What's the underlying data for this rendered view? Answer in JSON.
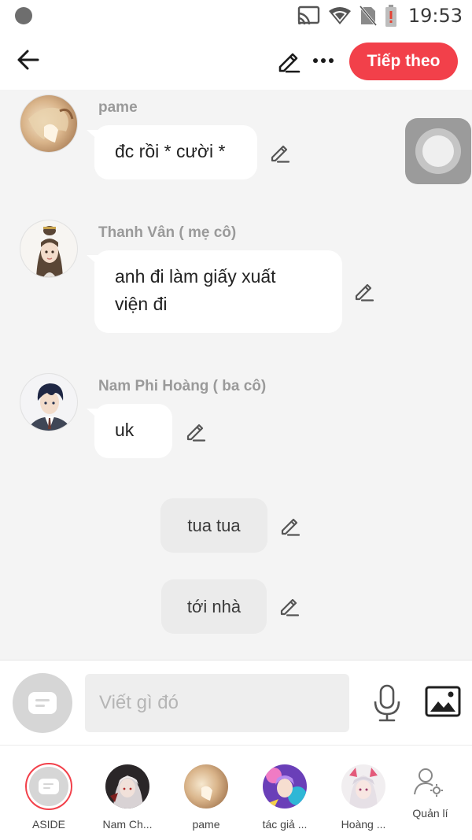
{
  "status_bar": {
    "time": "19:53",
    "icons": [
      "cast-icon",
      "wifi-icon",
      "no-sim-icon",
      "battery-alert-icon"
    ]
  },
  "header": {
    "back_icon": "arrow-left-icon",
    "edit_icon": "pencil-icon",
    "more_icon": "more-horizontal-icon",
    "next_label": "Tiếp theo",
    "accent_color": "#f2404a"
  },
  "messages": [
    {
      "sender": "pame",
      "text": "đc rồi * cười *",
      "avatar": "pame-avatar"
    },
    {
      "sender": "Thanh Vân ( mẹ cô)",
      "text": "anh đi làm giấy xuất\nviện đi",
      "avatar": "thanh-van-avatar"
    },
    {
      "sender": "Nam Phi Hoàng ( ba cô)",
      "text": "uk",
      "avatar": "nam-phi-hoang-avatar"
    }
  ],
  "narrations": [
    {
      "text": "tua tua"
    },
    {
      "text": "tới nhà"
    }
  ],
  "composer": {
    "placeholder": "Viết gì đó",
    "mic_icon": "microphone-icon",
    "image_icon": "image-icon"
  },
  "tabs": [
    {
      "label": "ASIDE",
      "icon": "chat-bubble-icon"
    },
    {
      "label": "Nam Ch...",
      "icon": "character-avatar"
    },
    {
      "label": "pame",
      "icon": "character-avatar"
    },
    {
      "label": "tác giả ...",
      "icon": "character-avatar"
    },
    {
      "label": "Hoàng ...",
      "icon": "character-avatar"
    },
    {
      "label": "Quản lí",
      "icon": "user-settings-icon"
    }
  ]
}
